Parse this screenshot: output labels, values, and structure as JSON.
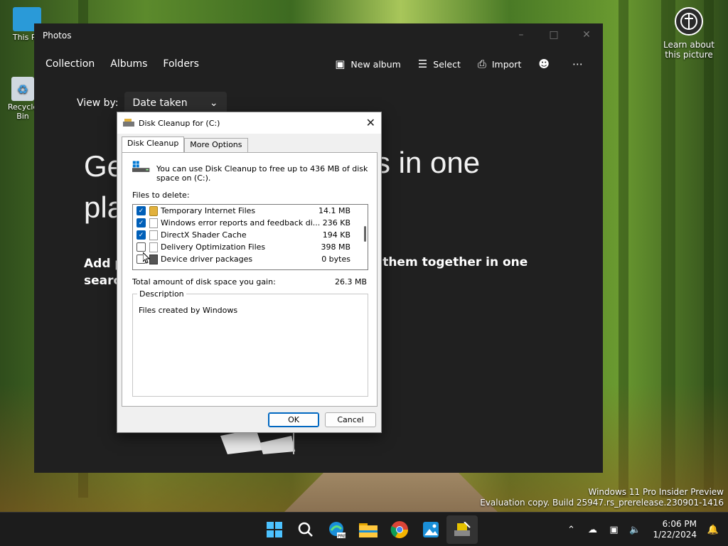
{
  "desktop": {
    "icons": [
      {
        "label": "This PC",
        "icon": "monitor-icon",
        "color": "#2a9ad8"
      },
      {
        "label": "Recycle Bin",
        "icon": "recycle-bin-icon",
        "color": "#3a9be0"
      }
    ],
    "learn_about": "Learn about this picture",
    "watermark_line1": "Windows 11 Pro Insider Preview",
    "watermark_line2": "Evaluation copy. Build 25947.rs_prerelease.230901-1416"
  },
  "photos": {
    "title": "Photos",
    "tabs": [
      "Collection",
      "Albums",
      "Folders"
    ],
    "actions": {
      "new_album": "New album",
      "select": "Select",
      "import": "Import"
    },
    "view_by_label": "View by:",
    "view_by_value": "Date taken",
    "hero_left": "Ge",
    "hero_left_line2": "pla",
    "hero_right": "s in one",
    "sub_left": "Add p",
    "sub_left_line2": "searc",
    "sub_right": "ng them together in one"
  },
  "dialog": {
    "title": "Disk Cleanup for  (C:)",
    "tabs": [
      "Disk Cleanup",
      "More Options"
    ],
    "info_text": "You can use Disk Cleanup to free up to 436 MB of disk space on  (C:).",
    "files_label": "Files to delete:",
    "files": [
      {
        "name": "Temporary Internet Files",
        "size": "14.1 MB",
        "checked": true,
        "icon": "lock-icon"
      },
      {
        "name": "Windows error reports and feedback di...",
        "size": "236 KB",
        "checked": true,
        "icon": "file-icon"
      },
      {
        "name": "DirectX Shader Cache",
        "size": "194 KB",
        "checked": true,
        "icon": "file-icon"
      },
      {
        "name": "Delivery Optimization Files",
        "size": "398 MB",
        "checked": false,
        "icon": "file-icon"
      },
      {
        "name": "Device driver packages",
        "size": "0 bytes",
        "checked": false,
        "icon": "drive-icon"
      }
    ],
    "total_label": "Total amount of disk space you gain:",
    "total_value": "26.3 MB",
    "description_label": "Description",
    "description_text": "Files created by Windows",
    "ok": "OK",
    "cancel": "Cancel",
    "accent": "#005fb8"
  },
  "taskbar": {
    "apps": [
      "start-icon",
      "search-icon",
      "edge-pre-icon",
      "file-explorer-icon",
      "chrome-icon",
      "photos-icon",
      "disk-cleanup-icon"
    ],
    "time": "6:06 PM",
    "date": "1/22/2024"
  }
}
